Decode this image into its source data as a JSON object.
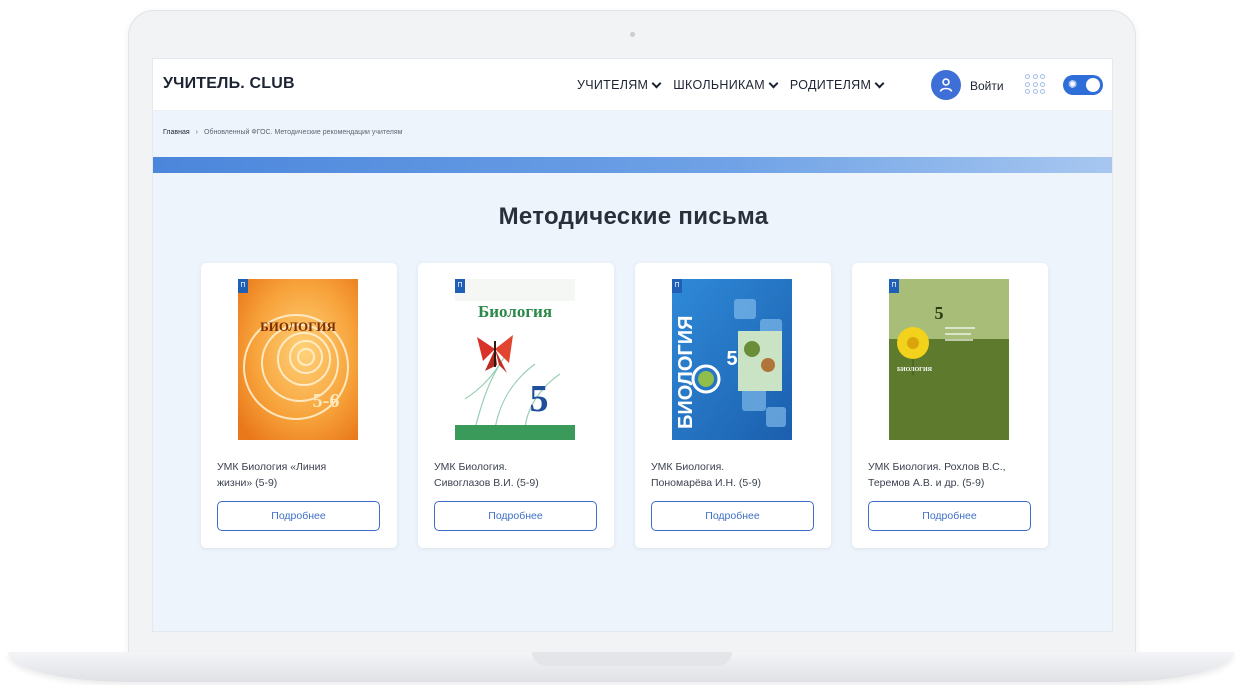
{
  "header": {
    "logo": "УЧИТЕЛЬ. CLUB",
    "nav": [
      {
        "label": "УЧИТЕЛЯМ"
      },
      {
        "label": "ШКОЛЬНИКАМ"
      },
      {
        "label": "РОДИТЕЛЯМ"
      }
    ],
    "login_label": "Войти"
  },
  "breadcrumb": {
    "home": "Главная",
    "separator": "›",
    "current": "Обновленный ФГОС. Методические рекомендации учителям"
  },
  "main": {
    "title": "Методические письма",
    "more_label": "Подробнее",
    "cards": [
      {
        "line1": "УМК Биология «Линия",
        "line2": "жизни» (5-9)",
        "cover_title": "БИОЛОГИЯ",
        "cover_grade": "5-6"
      },
      {
        "line1": "УМК Биология.",
        "line2": "Сивоглазов В.И. (5-9)",
        "cover_title": "Биология",
        "cover_grade": "5"
      },
      {
        "line1": "УМК Биология.",
        "line2": "Пономарёва И.Н. (5-9)",
        "cover_title": "БИОЛОГИЯ",
        "cover_grade": "5"
      },
      {
        "line1": "УМК Биология. Рохлов В.С.,",
        "line2": "Теремов А.В. и др. (5-9)",
        "cover_title": "БИОЛОГИЯ",
        "cover_grade": "5"
      }
    ]
  },
  "colors": {
    "accent": "#3e6fc7",
    "avatar": "#3d6fd6",
    "page_bg": "#eef4fb"
  }
}
